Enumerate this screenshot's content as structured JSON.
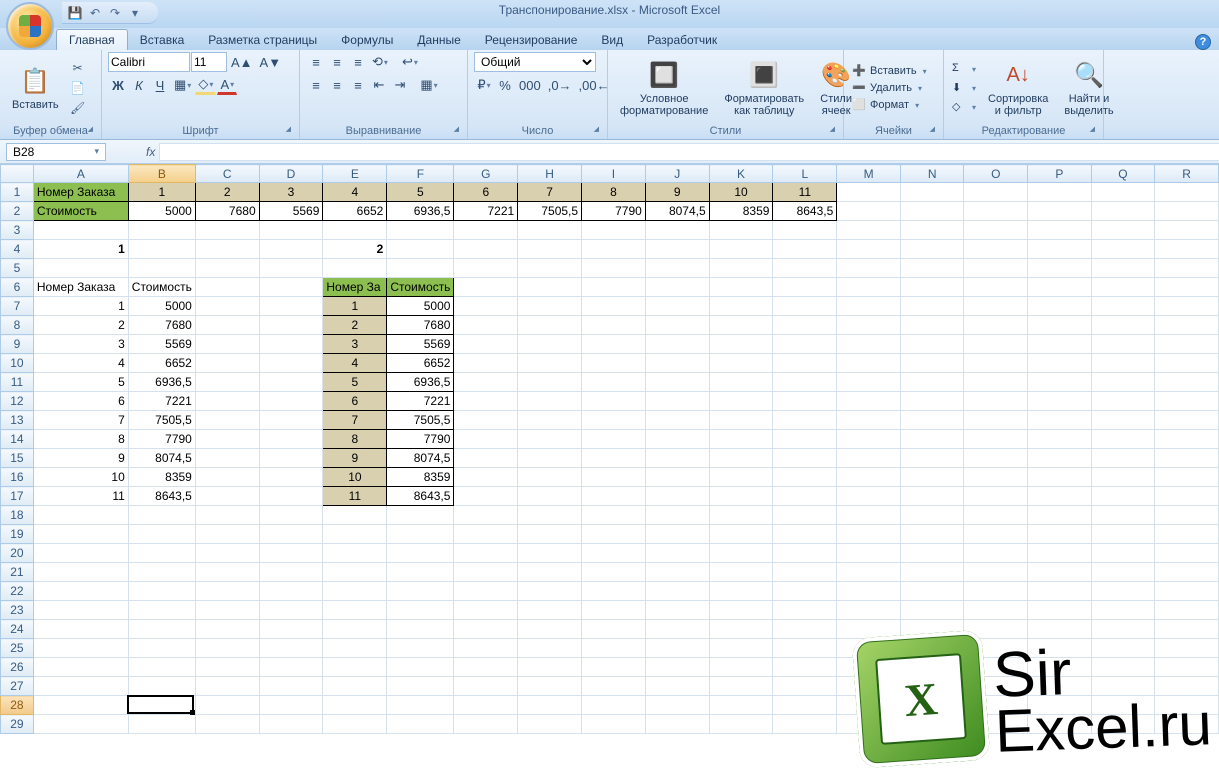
{
  "app": {
    "title": "Транспонирование.xlsx - Microsoft Excel"
  },
  "tabs": {
    "home": "Главная",
    "insert": "Вставка",
    "layout": "Разметка страницы",
    "formulas": "Формулы",
    "data": "Данные",
    "review": "Рецензирование",
    "view": "Вид",
    "dev": "Разработчик"
  },
  "ribbon": {
    "paste": "Вставить",
    "clipboard": "Буфер обмена",
    "font": "Шрифт",
    "align": "Выравнивание",
    "number": "Число",
    "styles": "Стили",
    "cells": "Ячейки",
    "editing": "Редактирование",
    "fontName": "Calibri",
    "fontSize": "11",
    "formatCombo": "Общий",
    "condFmt": "Условное\nформатирование",
    "asTable": "Форматировать\nкак таблицу",
    "cellStyles": "Стили\nячеек",
    "insertRow": "Вставить",
    "deleteRow": "Удалить",
    "formatRow": "Формат",
    "sort": "Сортировка\nи фильтр",
    "find": "Найти и\nвыделить"
  },
  "nameBox": "B28",
  "columns": [
    "A",
    "B",
    "C",
    "D",
    "E",
    "F",
    "G",
    "H",
    "I",
    "J",
    "K",
    "L",
    "M",
    "N",
    "O",
    "P",
    "Q",
    "R"
  ],
  "sheet": {
    "header1": "Номер Заказа",
    "header2": "Стоимость",
    "orders": [
      "1",
      "2",
      "3",
      "4",
      "5",
      "6",
      "7",
      "8",
      "9",
      "10",
      "11"
    ],
    "costs": [
      "5000",
      "7680",
      "5569",
      "6652",
      "6936,5",
      "7221",
      "7505,5",
      "7790",
      "8074,5",
      "8359",
      "8643,5"
    ],
    "lab1": "1",
    "lab2": "2",
    "h2a": "Номер За",
    "h2b": "Стоимость",
    "colA6": "Номер Заказа",
    "colB6": "Стоимость"
  },
  "watermark": {
    "line1": "Sir",
    "line2": "Excel.ru"
  }
}
